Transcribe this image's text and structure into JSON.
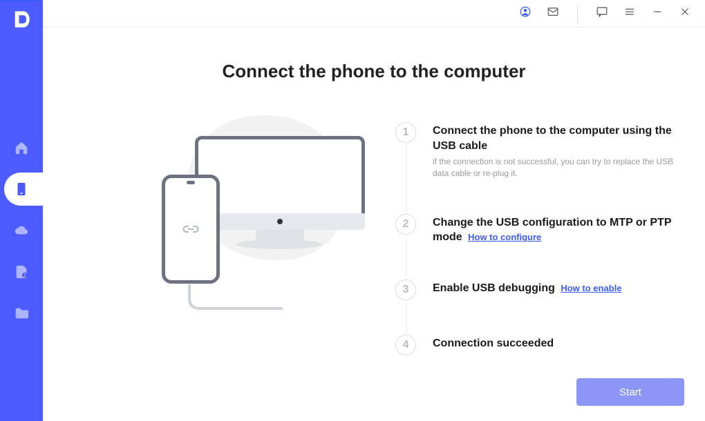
{
  "page": {
    "title": "Connect the phone to the computer"
  },
  "steps": [
    {
      "num": "1",
      "title": "Connect the phone to the computer using the USB cable",
      "subtitle": "if the connection is not successful, you can try to replace the USB data cable or re-plug it.",
      "link": ""
    },
    {
      "num": "2",
      "title": "Change the USB configuration to MTP or PTP mode",
      "subtitle": "",
      "link": "How to configure"
    },
    {
      "num": "3",
      "title": "Enable USB debugging",
      "subtitle": "",
      "link": "How to enable"
    },
    {
      "num": "4",
      "title": "Connection succeeded",
      "subtitle": "",
      "link": ""
    }
  ],
  "actions": {
    "start": "Start"
  }
}
